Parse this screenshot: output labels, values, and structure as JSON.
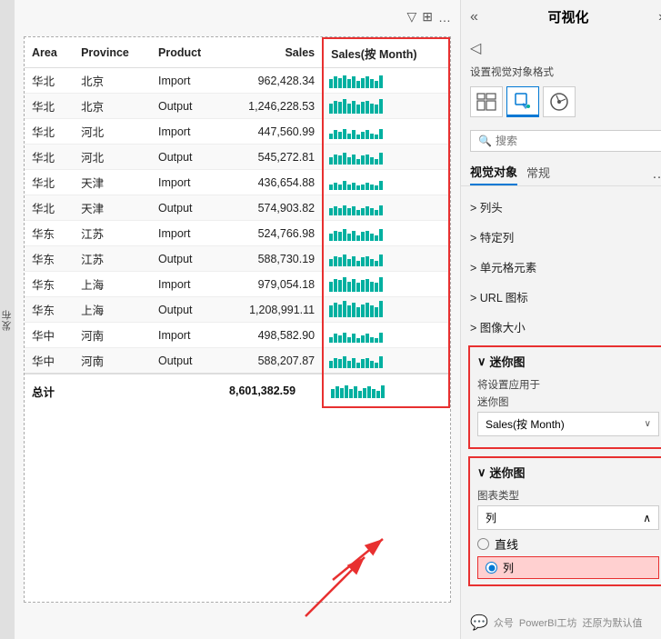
{
  "left_sidebar": {
    "vertical_text": "发布"
  },
  "toolbar": {
    "filter_icon": "▽",
    "table_icon": "⊞",
    "more_icon": "…"
  },
  "table": {
    "headers": [
      "Area",
      "Province",
      "Product",
      "Sales",
      "Sales(按 Month)"
    ],
    "rows": [
      {
        "area": "华北",
        "province": "北京",
        "product": "Import",
        "sales": "962,428.34",
        "sparkline": [
          6,
          8,
          7,
          9,
          6,
          8,
          5,
          7,
          8,
          6,
          5,
          9
        ]
      },
      {
        "area": "华北",
        "province": "北京",
        "product": "Output",
        "sales": "1,246,228.53",
        "sparkline": [
          7,
          9,
          8,
          10,
          7,
          9,
          6,
          8,
          9,
          7,
          6,
          10
        ]
      },
      {
        "area": "华北",
        "province": "河北",
        "product": "Import",
        "sales": "447,560.99",
        "sparkline": [
          4,
          6,
          5,
          7,
          4,
          6,
          3,
          5,
          6,
          4,
          3,
          7
        ]
      },
      {
        "area": "华北",
        "province": "河北",
        "product": "Output",
        "sales": "545,272.81",
        "sparkline": [
          5,
          7,
          6,
          8,
          5,
          7,
          4,
          6,
          7,
          5,
          4,
          8
        ]
      },
      {
        "area": "华北",
        "province": "天津",
        "product": "Import",
        "sales": "436,654.88",
        "sparkline": [
          4,
          5,
          4,
          6,
          4,
          5,
          3,
          4,
          5,
          4,
          3,
          6
        ]
      },
      {
        "area": "华北",
        "province": "天津",
        "product": "Output",
        "sales": "574,903.82",
        "sparkline": [
          5,
          6,
          5,
          7,
          5,
          6,
          4,
          5,
          6,
          5,
          4,
          7
        ]
      },
      {
        "area": "华东",
        "province": "江苏",
        "product": "Import",
        "sales": "524,766.98",
        "sparkline": [
          5,
          7,
          6,
          8,
          5,
          7,
          4,
          6,
          7,
          5,
          4,
          8
        ]
      },
      {
        "area": "华东",
        "province": "江苏",
        "product": "Output",
        "sales": "588,730.19",
        "sparkline": [
          5,
          7,
          6,
          8,
          5,
          7,
          4,
          6,
          7,
          5,
          4,
          8
        ]
      },
      {
        "area": "华东",
        "province": "上海",
        "product": "Import",
        "sales": "979,054.18",
        "sparkline": [
          7,
          9,
          8,
          10,
          7,
          9,
          6,
          8,
          9,
          7,
          6,
          10
        ]
      },
      {
        "area": "华东",
        "province": "上海",
        "product": "Output",
        "sales": "1,208,991.11",
        "sparkline": [
          8,
          10,
          9,
          11,
          8,
          10,
          7,
          9,
          10,
          8,
          7,
          11
        ]
      },
      {
        "area": "华中",
        "province": "河南",
        "product": "Import",
        "sales": "498,582.90",
        "sparkline": [
          4,
          6,
          5,
          7,
          4,
          6,
          3,
          5,
          6,
          4,
          3,
          7
        ]
      },
      {
        "area": "华中",
        "province": "河南",
        "product": "Output",
        "sales": "588,207.87",
        "sparkline": [
          5,
          7,
          6,
          8,
          5,
          7,
          4,
          6,
          7,
          5,
          4,
          8
        ]
      }
    ],
    "footer": {
      "label": "总计",
      "sales": "8,601,382.59",
      "sparkline": [
        6,
        8,
        7,
        9,
        6,
        8,
        5,
        7,
        8,
        6,
        5,
        9
      ]
    }
  },
  "right_panel": {
    "title": "可视化",
    "collapse_icon": "«",
    "expand_icon": "»",
    "audio_icon": "◁",
    "format_label": "设置视觉对象格式",
    "format_icons": [
      {
        "name": "grid-icon",
        "symbol": "⊞"
      },
      {
        "name": "paint-icon",
        "symbol": "🎨"
      },
      {
        "name": "chart-icon",
        "symbol": "⚙"
      }
    ],
    "search_placeholder": "搜索",
    "tabs": [
      "视觉对象",
      "常规"
    ],
    "sections": [
      {
        "label": "> 列头",
        "expanded": false
      },
      {
        "label": "> 特定列",
        "expanded": false
      },
      {
        "label": "> 单元格元素",
        "expanded": false
      },
      {
        "label": "> URL 图标",
        "expanded": false
      },
      {
        "label": "> 图像大小",
        "expanded": false
      }
    ],
    "sparkline_section1": {
      "title": "∨ 迷你图",
      "apply_label": "将设置应用于",
      "dropdown_label": "迷你图",
      "dropdown_value": "Sales(按 Month)",
      "dropdown_chevron": "∨"
    },
    "sparkline_section2": {
      "title": "∨ 迷你图",
      "chart_type_label": "图表类型",
      "chart_type_value": "列",
      "chart_type_chevron": "∧",
      "options": [
        {
          "label": "直线",
          "selected": false
        },
        {
          "label": "列",
          "selected": true,
          "highlighted": true
        }
      ]
    },
    "bottom_bar": {
      "wechat_label": "众号",
      "brand": "PowerBI工坊",
      "action": "还原为默认值"
    }
  }
}
